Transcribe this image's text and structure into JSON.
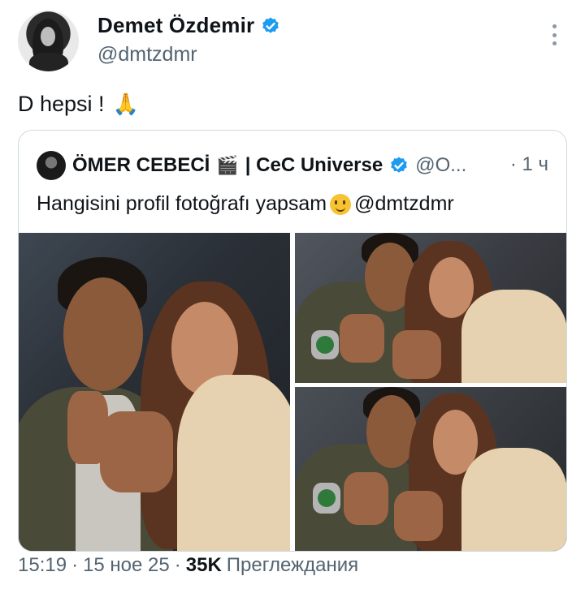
{
  "author": {
    "display_name": "Demet Özdemir",
    "handle": "@dmtzdmr",
    "verified": true
  },
  "tweet": {
    "text": "D hepsi !",
    "emoji": "🙏"
  },
  "quoted": {
    "name": "ÖMER CEBECİ",
    "name_emoji": "🎬",
    "name_suffix": "| CeC Universe",
    "handle": "@O...",
    "time": "· 1 ч",
    "text": "Hangisini profil fotoğrafı yapsam",
    "mention": "@dmtzdmr"
  },
  "meta": {
    "time": "15:19",
    "sep1": "·",
    "date": "15 ное 25",
    "sep2": "·",
    "views_count": "35K",
    "views_label": "Преглеждания"
  },
  "colors": {
    "verified_blue": "#1d9bf0",
    "secondary_text": "#536471"
  },
  "icons": [
    "more-icon",
    "verified-icon",
    "pray-emoji",
    "clapperboard-emoji",
    "melting-face-emoji"
  ]
}
